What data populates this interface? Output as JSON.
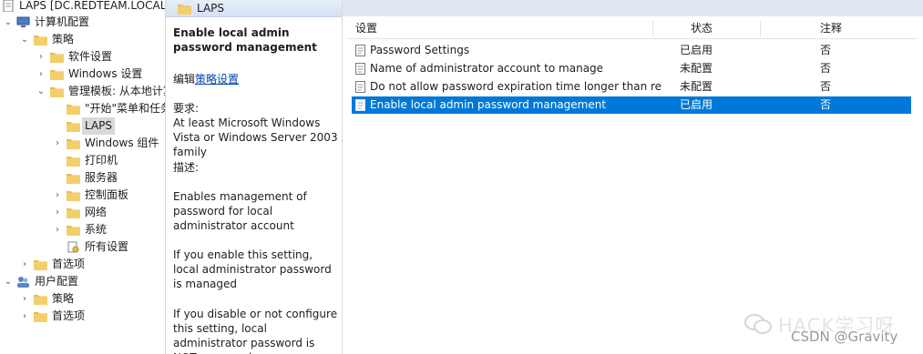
{
  "tree": {
    "root_label": "LAPS [DC.REDTEAM.LOCAL] 策",
    "computer_config": "计算机配置",
    "policies": "策略",
    "software_settings": "软件设置",
    "windows_settings": "Windows 设置",
    "admin_templates": "管理模板: 从本地计算",
    "start_menu": "\"开始\"菜单和任务",
    "laps": "LAPS",
    "windows_components": "Windows 组件",
    "printers": "打印机",
    "server": "服务器",
    "control_panel": "控制面板",
    "network": "网络",
    "system": "系统",
    "all_settings": "所有设置",
    "preferences_computer": "首选项",
    "user_config": "用户配置",
    "policies_user": "策略",
    "preferences_user": "首选项"
  },
  "desc": {
    "header": "LAPS",
    "title": "Enable local admin password management",
    "edit_prefix": "编辑",
    "edit_link": "策略设置",
    "req_label": "要求:",
    "req_text": "At least Microsoft Windows Vista or Windows Server 2003 family",
    "desc_label": "描述:",
    "p1": "Enables management of password for local administrator account",
    "p2": "If you enable this setting, local administrator password is managed",
    "p3": "If you disable or not configure this setting, local administrator password is NOT managed"
  },
  "list": {
    "col_setting": "设置",
    "col_state": "状态",
    "col_comment": "注释",
    "rows": [
      {
        "name": "Password Settings",
        "state": "已启用",
        "comment": "否"
      },
      {
        "name": "Name of administrator account to manage",
        "state": "未配置",
        "comment": "否"
      },
      {
        "name": "Do not allow password expiration time longer than re...",
        "state": "未配置",
        "comment": "否"
      },
      {
        "name": "Enable local admin password management",
        "state": "已启用",
        "comment": "否"
      }
    ]
  },
  "watermark": {
    "brand": "HACK学习呀",
    "credit": "CSDN @Gravity"
  },
  "colors": {
    "selection": "#0078d7",
    "folder": "#e8bd4f",
    "link": "#0645ad"
  }
}
